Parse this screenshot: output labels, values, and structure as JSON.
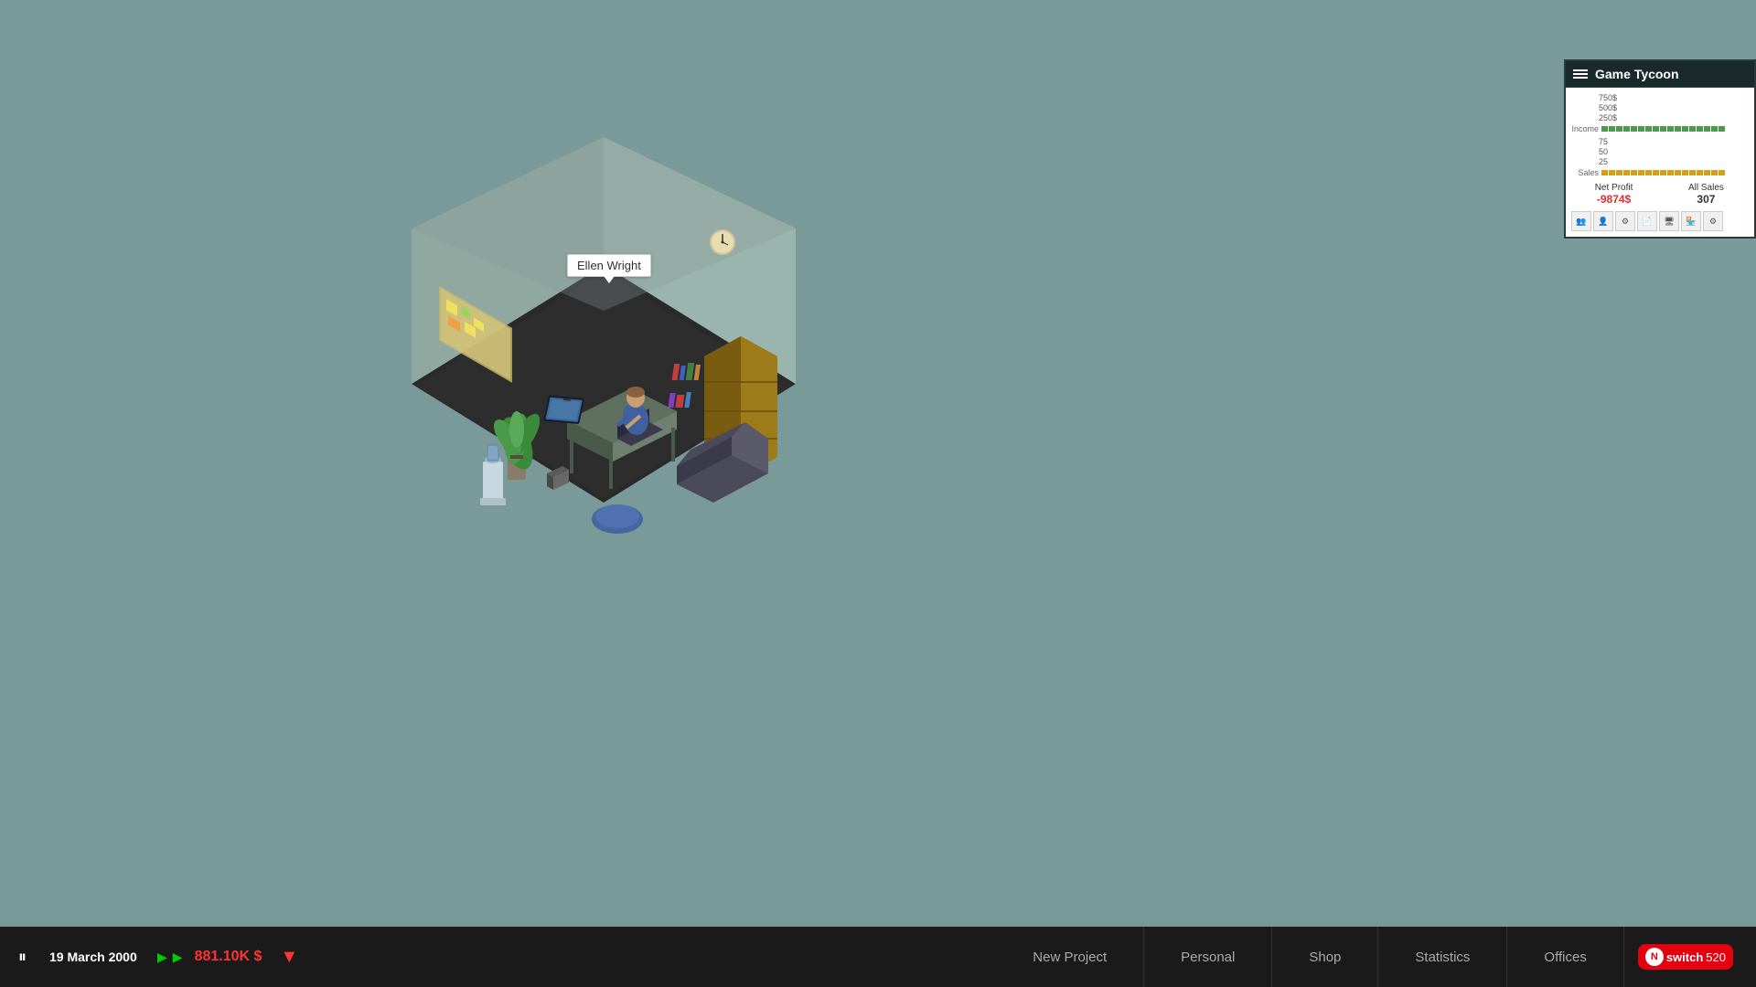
{
  "game": {
    "title": "Game Tycoon",
    "background_color": "#7a9a9a"
  },
  "character_tooltip": {
    "name": "Ellen Wright"
  },
  "stats_panel": {
    "title": "Game Tycoon",
    "menu_icon_label": "menu",
    "chart": {
      "y_labels": [
        "750$",
        "500$",
        "250$"
      ],
      "income_label": "Income",
      "sales_label": "Sales",
      "y_labels2": [
        "75",
        "50",
        "25"
      ],
      "income_bars": [
        1,
        1,
        1,
        1,
        1,
        1,
        1,
        1,
        1,
        1,
        1,
        1,
        1,
        1,
        1,
        1,
        1
      ],
      "sales_bars": [
        1,
        1,
        1,
        1,
        1,
        1,
        1,
        1,
        1,
        1,
        1,
        1,
        1,
        1,
        1,
        1,
        1
      ]
    },
    "net_profit_label": "Net Profit",
    "net_profit_value": "-9874$",
    "all_sales_label": "All Sales",
    "all_sales_value": "307",
    "toolbar_icons": [
      "people",
      "person",
      "gear",
      "doc",
      "monitor",
      "shop",
      "settings2"
    ]
  },
  "taskbar": {
    "pause_icon": "⏸",
    "date": "19 March 2000",
    "speed1_icon": "▶",
    "speed2_icon": "▶",
    "money": "881.10K $",
    "warning_icon": "▼",
    "new_project_label": "New Project",
    "personal_label": "Personal",
    "shop_label": "Shop",
    "statistics_label": "Statistics",
    "offices_label": "Offices",
    "nintendo_text": "switch",
    "nintendo_number": "520"
  }
}
